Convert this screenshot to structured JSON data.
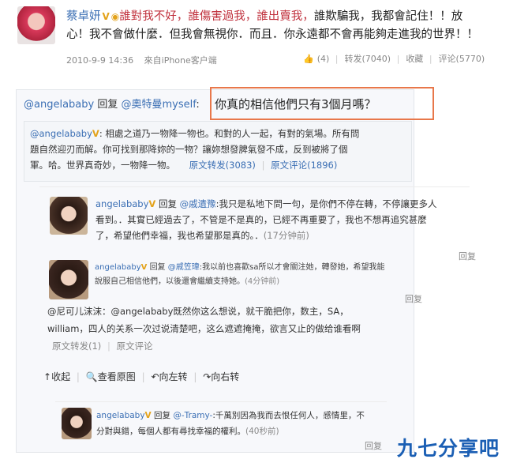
{
  "post": {
    "author": "蔡卓妍",
    "text_red": "誰對我不好，誰傷害過我，誰出賣我，",
    "text_rest_line1": "誰欺騙我，我都會記住！！放",
    "text_line2": "心！我不會做什麼．但我會無視你．而且．你永遠都不會再能夠走進我的世界！！",
    "time": "2010-9-9 14:36",
    "source": "來自iPhone客户端",
    "like": "(4)",
    "repost": "转发(7040)",
    "fav": "收藏",
    "comment": "评论(5770)"
  },
  "reply_main": {
    "user": "@angelababy",
    "action": "回复",
    "target": "@奧特曼myself",
    "colon": ":",
    "text": "你真的相信他們只有3個月嗎？"
  },
  "quoted": {
    "user": "@angelababy",
    "line1": ": 相處之道乃一物降一物也。和對的人一起，有對的氣場。所有問",
    "line2": "題自然迎刃而解。你可找到那降妳的一物？讓妳想發脾氣發不成，反到被將了個",
    "line3": "軍。哈。世界真奇妙，一物降一物。",
    "repost": "原文转发(3083)",
    "comment": "原文评论(1896)"
  },
  "c1": {
    "user": "angelababy",
    "action": "回复",
    "target": "@戚遺豫",
    "line1": ":我只是私地下問一句，是你們不停在轉，不停讓更多人",
    "line2": "看到。．其實已經過去了，不管是不是真的，已經不再重要了，我也不想再追究甚麼",
    "line3": "了，希望他們幸福，我也希望那是真的。．",
    "time": "(17分钟前)",
    "reply": "回复"
  },
  "c2": {
    "user": "angelababy",
    "action": "回复",
    "target": "@戚笠瑋",
    "line1": ":我以前也喜歡sa所以才會關注她，轉發她，希望我能",
    "line2": "說服自己相信他們，以後還會繼續支持她。",
    "time": "(4分钟前)",
    "reply": "回复"
  },
  "c3": {
    "line1": "@尼可儿沫沫：@angelababy既然你这么想说，就干脆把你，数主，SA，",
    "line2": "william，四人的关系一次过说清楚吧，这么遮遮掩掩，欲言又止的做给谁看啊",
    "repost": "原文转发(1)",
    "comment": "原文评论"
  },
  "toolbar": {
    "collapse": "收起",
    "view": "查看原图",
    "left": "向左转",
    "right": "向右转"
  },
  "c4": {
    "user": "angelababy",
    "action": "回复",
    "target": "@-Tramy-",
    "line1": ":千萬別因為我而去恨任何人，感情里，不",
    "line2": "分對與錯，每個人都有尋找幸福的權利。",
    "time": "(40秒前)",
    "reply": "回复"
  },
  "watermark": "九七分享吧",
  "colors": {
    "highlight_box": "#e8774a",
    "accent_red": "#c0303c",
    "link": "#3b6fb4",
    "watermark": "#1b5fb4"
  }
}
